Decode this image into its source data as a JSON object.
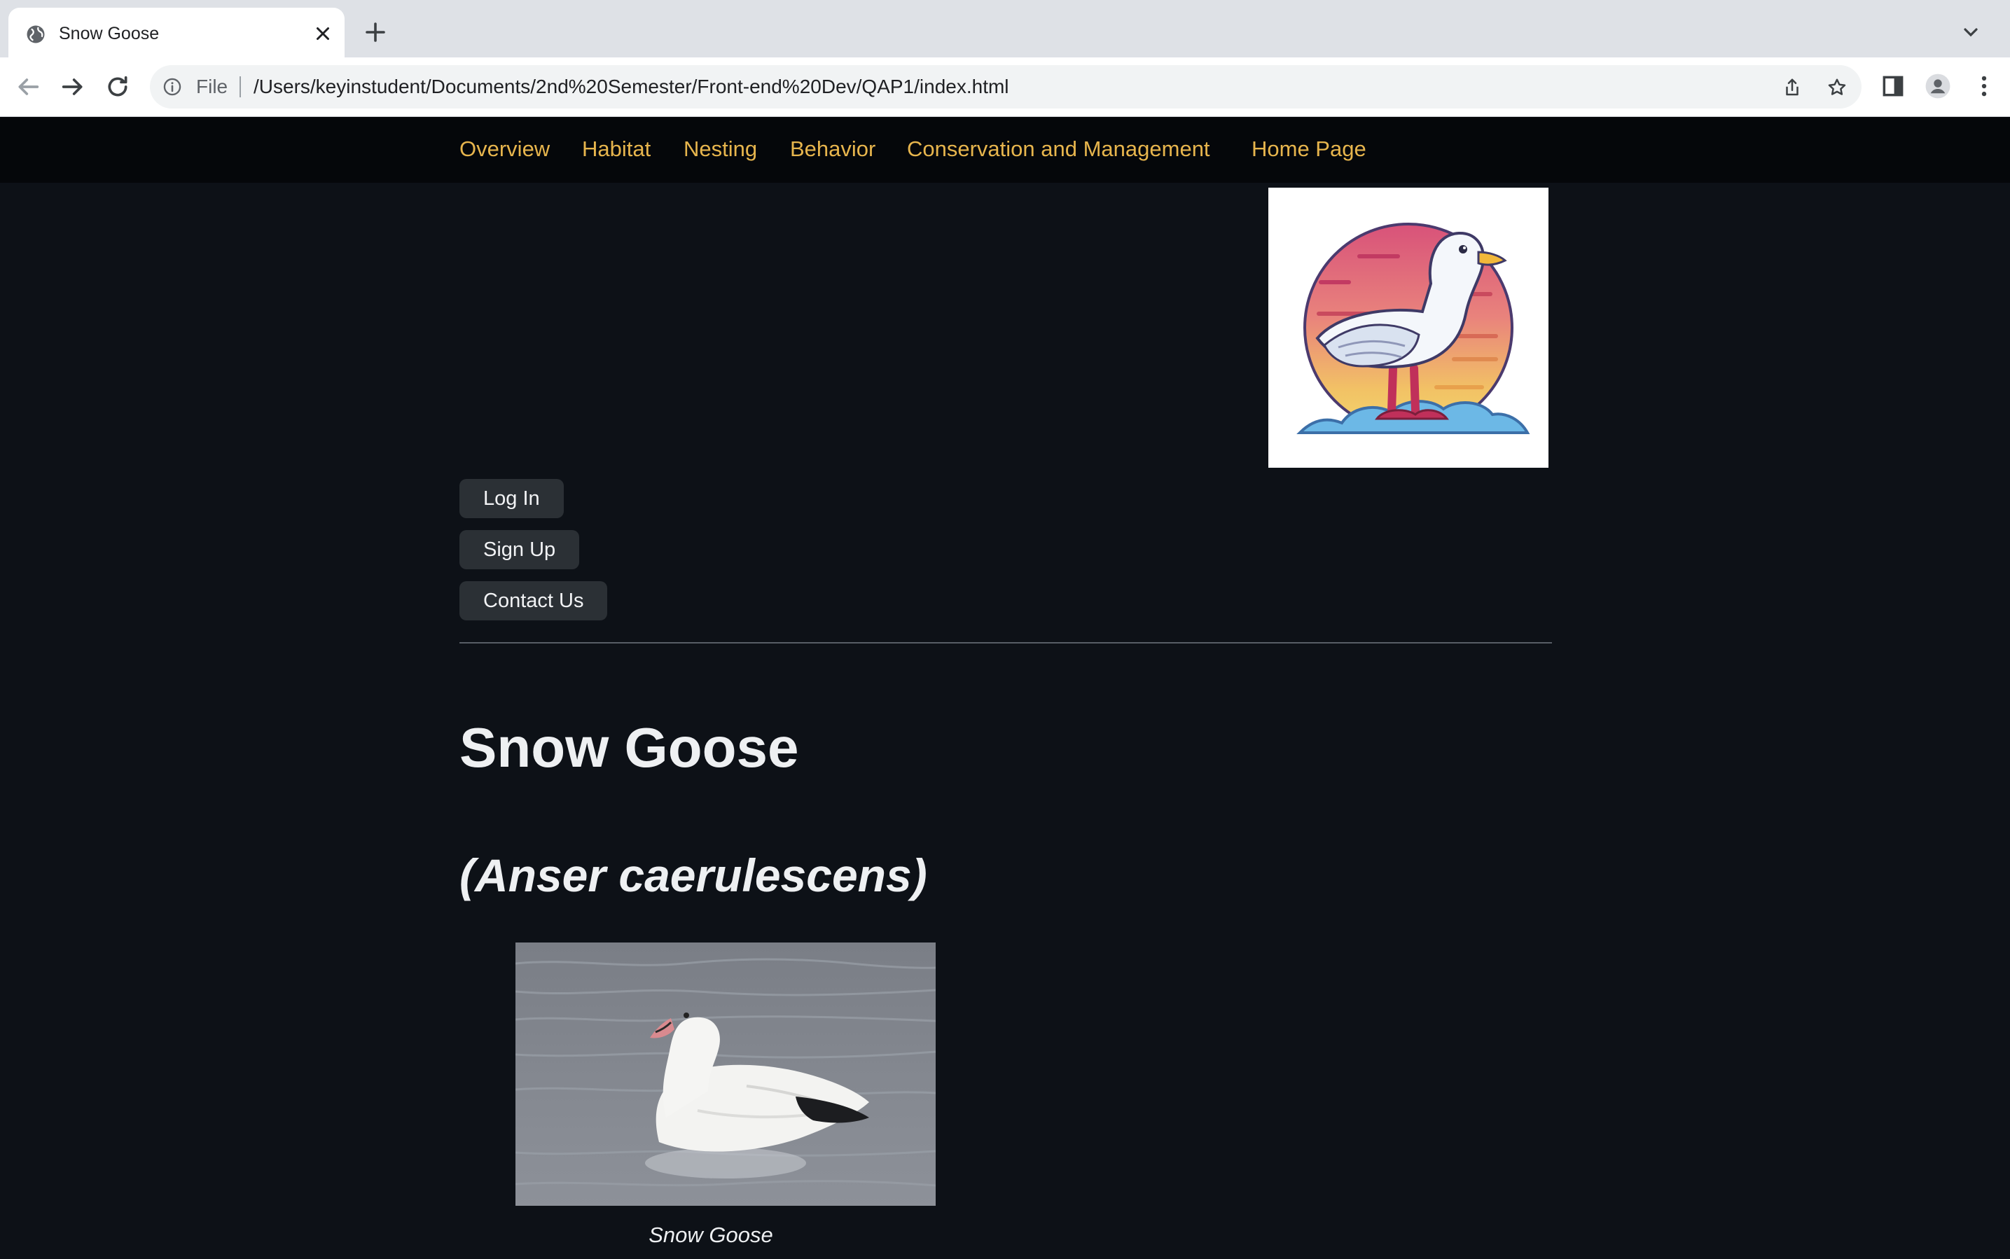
{
  "browser": {
    "tab_title": "Snow Goose",
    "file_label": "File",
    "url": "/Users/keyinstudent/Documents/2nd%20Semester/Front-end%20Dev/QAP1/index.html"
  },
  "nav": {
    "links": [
      "Overview",
      "Habitat",
      "Nesting",
      "Behavior",
      "Conservation and Management",
      "Home Page"
    ]
  },
  "buttons": {
    "login": "Log In",
    "signup": "Sign Up",
    "contact": "Contact Us"
  },
  "content": {
    "title": "Snow Goose",
    "scientific_name": "(Anser caerulescens)",
    "photo_caption": "Snow Goose"
  },
  "colors": {
    "page_background": "#0d1117",
    "nav_background": "#05070a",
    "nav_link": "#e7b54d",
    "button_background": "#2b3035"
  },
  "icons": {
    "tab": "globe-icon",
    "omnibox": "info-icon",
    "logo": "goose-logo"
  }
}
